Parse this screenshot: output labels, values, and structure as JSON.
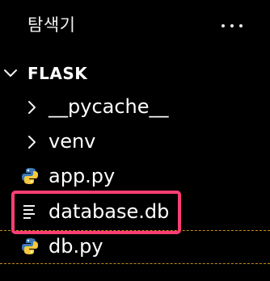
{
  "panel": {
    "title": "탐색기",
    "more_icon": "more-icon",
    "root_label": "FLASK",
    "items": [
      {
        "type": "folder",
        "name": "__pycache__",
        "icon": "chevron-right-icon"
      },
      {
        "type": "folder",
        "name": "venv",
        "icon": "chevron-right-icon"
      },
      {
        "type": "file",
        "name": "app.py",
        "icon": "python-icon"
      },
      {
        "type": "file",
        "name": "database.db",
        "icon": "document-lines-icon",
        "selected": true
      },
      {
        "type": "file",
        "name": "db.py",
        "icon": "python-icon"
      }
    ]
  },
  "colors": {
    "background": "#000000",
    "text": "#ffffff",
    "selection_outline": "#ff3d73",
    "python_blue": "#3b79b8",
    "python_yellow": "#f6c83d",
    "drop_guide": "#c58a25"
  }
}
